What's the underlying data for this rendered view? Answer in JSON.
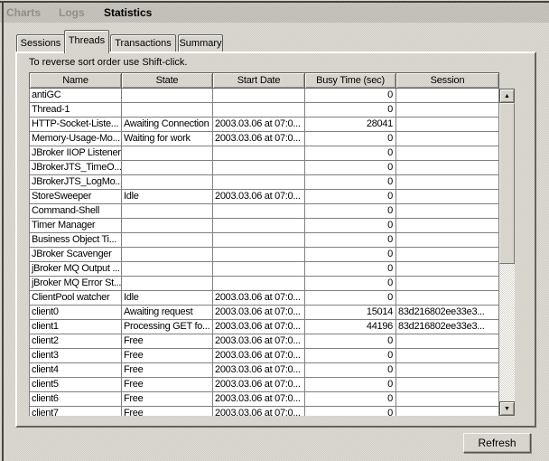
{
  "menubar": {
    "items": [
      {
        "label": "Charts",
        "enabled": false
      },
      {
        "label": "Logs",
        "enabled": false
      },
      {
        "label": "Statistics",
        "enabled": true
      }
    ]
  },
  "tabs": [
    {
      "label": "Sessions",
      "selected": false
    },
    {
      "label": "Threads",
      "selected": true
    },
    {
      "label": "Transactions",
      "selected": false
    },
    {
      "label": "Summary",
      "selected": false
    }
  ],
  "note": "To reverse sort order use Shift-click.",
  "table": {
    "columns": [
      "Name",
      "State",
      "Start Date",
      "Busy Time (sec)",
      "Session"
    ],
    "rows": [
      {
        "name": "antiGC",
        "state": "",
        "start_date": "",
        "busy_time": "0",
        "session": ""
      },
      {
        "name": "Thread-1",
        "state": "",
        "start_date": "",
        "busy_time": "0",
        "session": ""
      },
      {
        "name": "HTTP-Socket-Liste...",
        "state": "Awaiting Connection",
        "start_date": "2003.03.06 at 07:0...",
        "busy_time": "28041",
        "session": ""
      },
      {
        "name": "Memory-Usage-Mo...",
        "state": "Waiting for work",
        "start_date": "2003.03.06 at 07:0...",
        "busy_time": "0",
        "session": ""
      },
      {
        "name": "JBroker IIOP Listener",
        "state": "",
        "start_date": "",
        "busy_time": "0",
        "session": ""
      },
      {
        "name": "JBrokerJTS_TimeO...",
        "state": "",
        "start_date": "",
        "busy_time": "0",
        "session": ""
      },
      {
        "name": "JBrokerJTS_LogMo...",
        "state": "",
        "start_date": "",
        "busy_time": "0",
        "session": ""
      },
      {
        "name": "StoreSweeper",
        "state": "Idle",
        "start_date": "2003.03.06 at 07:0...",
        "busy_time": "0",
        "session": ""
      },
      {
        "name": "Command-Shell",
        "state": "",
        "start_date": "",
        "busy_time": "0",
        "session": ""
      },
      {
        "name": "Timer Manager",
        "state": "",
        "start_date": "",
        "busy_time": "0",
        "session": ""
      },
      {
        "name": "Business Object Ti...",
        "state": "",
        "start_date": "",
        "busy_time": "0",
        "session": ""
      },
      {
        "name": "JBroker Scavenger",
        "state": "",
        "start_date": "",
        "busy_time": "0",
        "session": ""
      },
      {
        "name": "jBroker MQ Output ...",
        "state": "",
        "start_date": "",
        "busy_time": "0",
        "session": ""
      },
      {
        "name": "jBroker MQ Error St...",
        "state": "",
        "start_date": "",
        "busy_time": "0",
        "session": ""
      },
      {
        "name": "ClientPool watcher",
        "state": "Idle",
        "start_date": "2003.03.06 at 07:0...",
        "busy_time": "0",
        "session": ""
      },
      {
        "name": "client0",
        "state": "Awaiting request",
        "start_date": "2003.03.06 at 07:0...",
        "busy_time": "15014",
        "session": "83d216802ee33e3..."
      },
      {
        "name": "client1",
        "state": "Processing GET fo...",
        "start_date": "2003.03.06 at 07:0...",
        "busy_time": "44196",
        "session": "83d216802ee33e3..."
      },
      {
        "name": "client2",
        "state": "Free",
        "start_date": "2003.03.06 at 07:0...",
        "busy_time": "0",
        "session": ""
      },
      {
        "name": "client3",
        "state": "Free",
        "start_date": "2003.03.06 at 07:0...",
        "busy_time": "0",
        "session": ""
      },
      {
        "name": "client4",
        "state": "Free",
        "start_date": "2003.03.06 at 07:0...",
        "busy_time": "0",
        "session": ""
      },
      {
        "name": "client5",
        "state": "Free",
        "start_date": "2003.03.06 at 07:0...",
        "busy_time": "0",
        "session": ""
      },
      {
        "name": "client6",
        "state": "Free",
        "start_date": "2003.03.06 at 07:0...",
        "busy_time": "0",
        "session": ""
      },
      {
        "name": "client7",
        "state": "Free",
        "start_date": "2003.03.06 at 07:0...",
        "busy_time": "0",
        "session": ""
      }
    ]
  },
  "scrollbar": {
    "up_icon": "▲",
    "down_icon": "▼"
  },
  "refresh_button": {
    "label": "Refresh"
  },
  "colors": {
    "background": "#d9d6cf",
    "menubar_background": "#c6c3bc",
    "disabled_text": "#8f8f89",
    "grid_line": "#808080",
    "row_background": "#ffffff",
    "frame_line": "#45453d"
  }
}
